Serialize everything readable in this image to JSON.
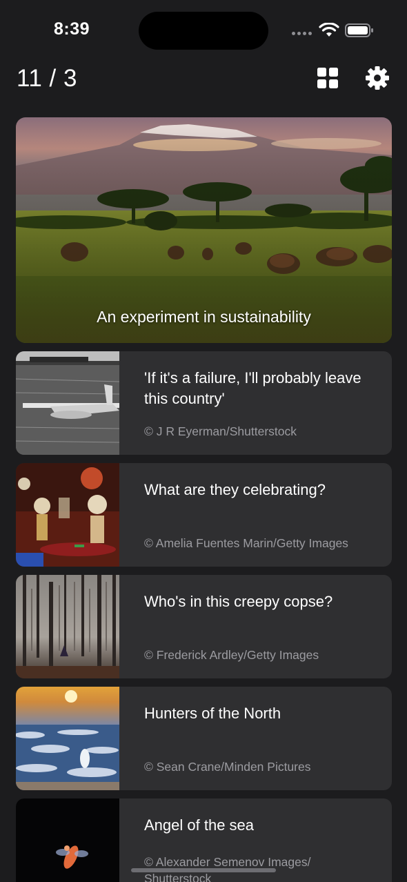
{
  "status_bar": {
    "time": "8:39"
  },
  "header": {
    "counter": "11 / 3",
    "grid_icon": "grid-icon",
    "settings_icon": "gear-icon"
  },
  "hero": {
    "caption": "An experiment in sustainability"
  },
  "cards": [
    {
      "title": "'If it's a failure, I'll probably leave this country'",
      "credit": "© J R Eyerman/Shutterstock"
    },
    {
      "title": "What are they celebrating?",
      "credit": "© Amelia Fuentes Marin/Getty Images"
    },
    {
      "title": "Who's in this creepy copse?",
      "credit": "© Frederick Ardley/Getty Images"
    },
    {
      "title": "Hunters of the North",
      "credit": "© Sean Crane/Minden Pictures"
    },
    {
      "title": "Angel of the sea",
      "credit": "© Alexander Semenov Images/ Shutterstock"
    }
  ]
}
